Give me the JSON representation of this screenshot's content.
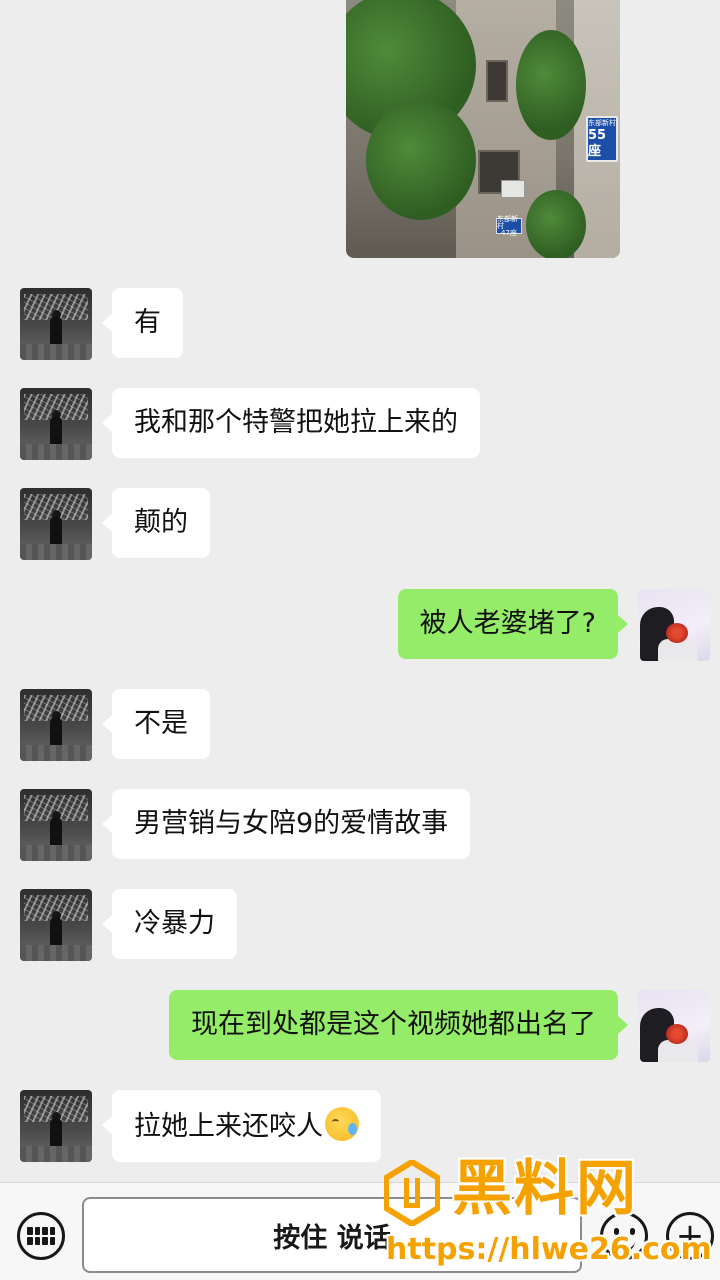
{
  "photo": {
    "sign_main_small": "东部新村",
    "sign_main_big": "55座",
    "sign_small_1": "东部新村",
    "sign_small_2": "47座"
  },
  "messages": [
    {
      "side": "left",
      "text": "有"
    },
    {
      "side": "left",
      "text": "我和那个特警把她拉上来的"
    },
    {
      "side": "left",
      "text": "颠的"
    },
    {
      "side": "right",
      "text": "被人老婆堵了?"
    },
    {
      "side": "left",
      "text": "不是"
    },
    {
      "side": "left",
      "text": "男营销与女陪9的爱情故事"
    },
    {
      "side": "left",
      "text": "冷暴力"
    },
    {
      "side": "right",
      "text": "现在到处都是这个视频她都出名了"
    },
    {
      "side": "left",
      "text": "拉她上来还咬人",
      "emoji": "crying-laughing-emoji"
    }
  ],
  "toolbar": {
    "keyboard_icon": "keyboard-icon",
    "hold_to_talk_label": "按住 说话",
    "emoji_icon": "emoji-icon",
    "plus_icon": "plus-icon"
  },
  "watermark": {
    "title": "黑料网",
    "url": "https://hlwe26.com"
  },
  "colors": {
    "background": "#ededed",
    "bubble_self": "#95ec69",
    "bubble_other": "#ffffff",
    "watermark": "#f5a100"
  }
}
